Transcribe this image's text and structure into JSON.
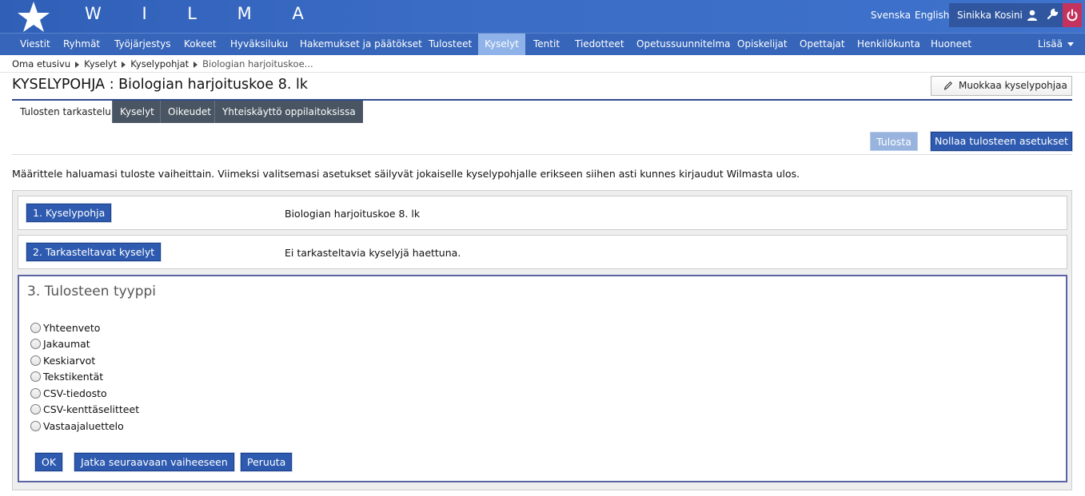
{
  "header": {
    "brand": "W I L M A",
    "languages": [
      "Svenska",
      "English"
    ],
    "user_name": "Sinikka Kosini"
  },
  "nav": {
    "items": [
      "Viestit",
      "Ryhmät",
      "Työjärjestys",
      "Kokeet",
      "Hyväksiluku",
      "Hakemukset ja päätökset",
      "Tulosteet",
      "Kyselyt",
      "Tentit",
      "Tiedotteet",
      "Opetussuunnitelma",
      "Opiskelijat",
      "Opettajat",
      "Henkilökunta",
      "Huoneet"
    ],
    "active": "Kyselyt",
    "more_label": "Lisää"
  },
  "breadcrumb": [
    "Oma etusivu",
    "Kyselyt",
    "Kyselypohjat",
    "Biologian harjoituskoe..."
  ],
  "page": {
    "title": "KYSELYPOHJA : Biologian harjoituskoe 8. lk",
    "edit_button": "Muokkaa kyselypohjaa"
  },
  "tabs": [
    "Tulosten tarkastelu",
    "Kyselyt",
    "Oikeudet",
    "Yhteiskäyttö oppilaitoksissa"
  ],
  "actions": {
    "print": "Tulosta",
    "reset": "Nollaa tulosteen asetukset"
  },
  "intro": "Määrittele haluamasi tuloste vaiheittain. Viimeksi valitsemasi asetukset säilyvät jokaiselle kyselypohjalle erikseen siihen asti kunnes kirjaudut Wilmasta ulos.",
  "steps": {
    "step1": {
      "button": "1. Kyselypohja",
      "value": "Biologian harjoituskoe 8. lk"
    },
    "step2": {
      "button": "2. Tarkasteltavat kyselyt",
      "value": "Ei tarkasteltavia kyselyjä haettuna."
    },
    "step3": {
      "title": "3. Tulosteen tyyppi",
      "options": [
        "Yhteenveto",
        "Jakaumat",
        "Keskiarvot",
        "Tekstikentät",
        "CSV-tiedosto",
        "CSV-kenttäselitteet",
        "Vastaajaluettelo"
      ],
      "buttons": {
        "ok": "OK",
        "next": "Jatka seuraavaan vaiheeseen",
        "cancel": "Peruuta"
      }
    }
  },
  "colors": {
    "header_blue": "#3b6cc5",
    "nav_blue": "#3665b9",
    "active_tab": "#8fb3e8",
    "button_blue": "#2e5bb0",
    "power_red": "#c4335d",
    "step3_border": "#5a63a3"
  }
}
